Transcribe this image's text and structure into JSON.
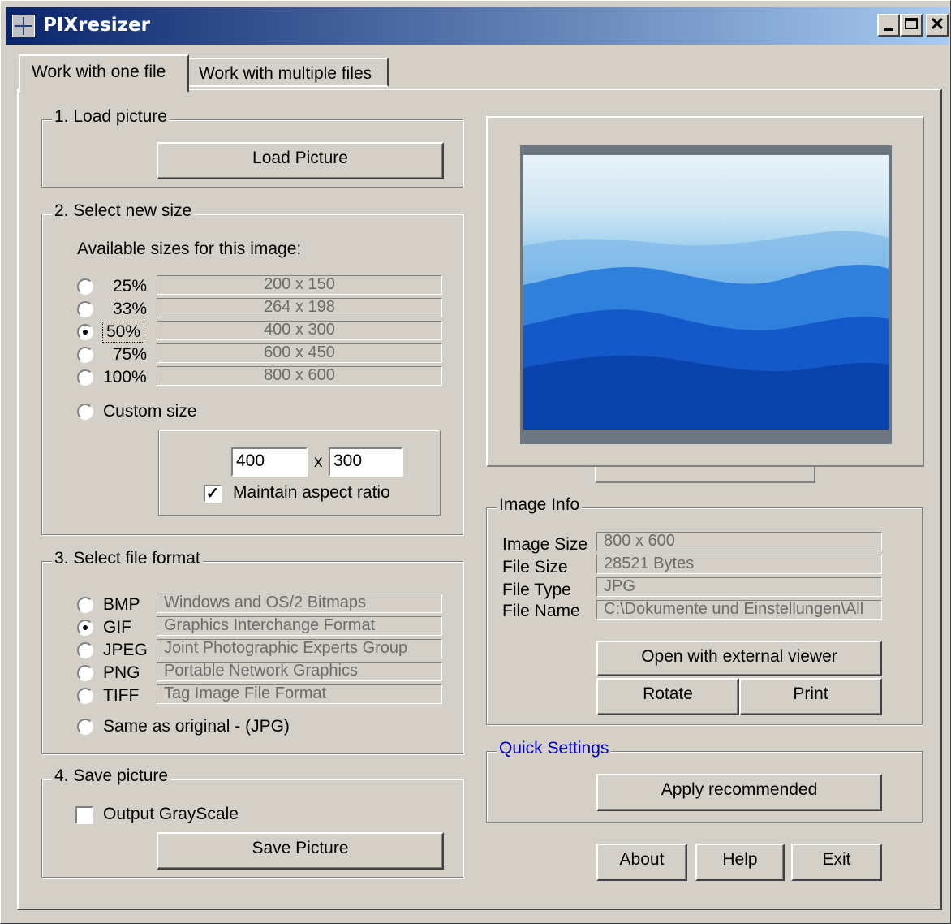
{
  "window": {
    "title": "PIXresizer",
    "minimize": "_",
    "maximize": "□",
    "close": "✕"
  },
  "tabs": [
    {
      "label": "Work with one file"
    },
    {
      "label": "Work with multiple files"
    }
  ],
  "load": {
    "group": "1. Load picture",
    "button": "Load Picture"
  },
  "size": {
    "group": "2. Select new size",
    "available_label": "Available sizes for this image:",
    "options": [
      {
        "percent": "25%",
        "dims": "200 x 150",
        "selected": false
      },
      {
        "percent": "33%",
        "dims": "264 x 198",
        "selected": false
      },
      {
        "percent": "50%",
        "dims": "400 x 300",
        "selected": true
      },
      {
        "percent": "75%",
        "dims": "600 x 450",
        "selected": false
      },
      {
        "percent": "100%",
        "dims": "800 x 600",
        "selected": false
      }
    ],
    "custom_label": "Custom size",
    "custom_width": "400",
    "custom_sep": "x",
    "custom_height": "300",
    "maintain_label": "Maintain aspect ratio",
    "maintain_checked": true
  },
  "format": {
    "group": "3. Select file format",
    "options": [
      {
        "name": "BMP",
        "desc": "Windows and OS/2 Bitmaps",
        "selected": false
      },
      {
        "name": "GIF",
        "desc": "Graphics Interchange Format",
        "selected": true
      },
      {
        "name": "JPEG",
        "desc": "Joint Photographic Experts Group",
        "selected": false
      },
      {
        "name": "PNG",
        "desc": "Portable Network Graphics",
        "selected": false
      },
      {
        "name": "TIFF",
        "desc": "Tag Image File Format",
        "selected": false
      }
    ],
    "same_label": "Same as original  - (JPG)"
  },
  "save": {
    "group": "4. Save picture",
    "grayscale_label": "Output GrayScale",
    "grayscale_checked": false,
    "button": "Save Picture"
  },
  "info": {
    "group": "Image Info",
    "rows": [
      {
        "label": "Image Size",
        "value": "800 x 600"
      },
      {
        "label": "File Size",
        "value": "28521 Bytes"
      },
      {
        "label": "File Type",
        "value": "JPG"
      },
      {
        "label": "File Name",
        "value": "C:\\Dokumente und Einstellungen\\All"
      }
    ],
    "open_button": "Open with external viewer",
    "rotate_button": "Rotate",
    "print_button": "Print"
  },
  "quick": {
    "group": "Quick Settings",
    "apply_button": "Apply recommended"
  },
  "footer": {
    "about": "About",
    "help": "Help",
    "exit": "Exit"
  }
}
